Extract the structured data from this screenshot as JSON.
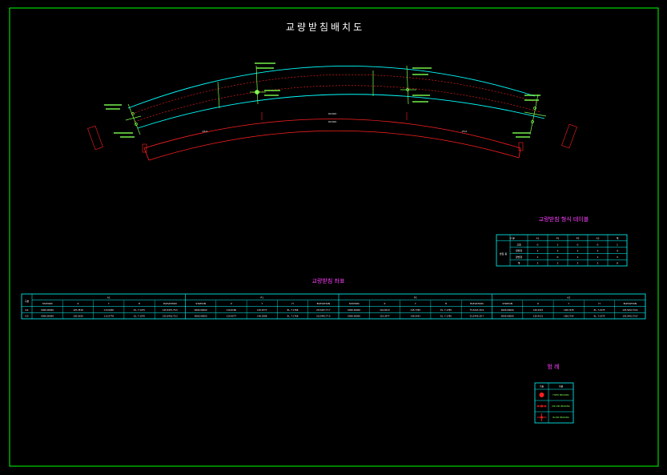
{
  "title": "교량받침배치도",
  "summary_table": {
    "title": "교량받침 형식 테이블",
    "header": [
      "구 분",
      "A1",
      "P1",
      "P2",
      "A2",
      "계"
    ],
    "group_label": "받침 종",
    "rows": [
      [
        "고정",
        "0",
        "1",
        "0",
        "0",
        "1"
      ],
      [
        "일방향",
        "1",
        "1",
        "1",
        "1",
        "4"
      ],
      [
        "양방향",
        "1",
        "0",
        "1",
        "1",
        "3"
      ],
      [
        "계",
        "2",
        "2",
        "2",
        "2",
        "8"
      ]
    ]
  },
  "coord_table": {
    "title": "교량받침 좌표",
    "corner_label": "구분",
    "groups": [
      "A1",
      "P1",
      "P2",
      "A2"
    ],
    "subheader": [
      "STATION",
      "X",
      "Y",
      "H",
      "ELEVATION"
    ],
    "row_labels": [
      "G1",
      "G2"
    ],
    "rows": [
      [
        "0000.00000",
        "125.7818",
        "113.0200",
        "EL. 7.1275",
        "125,5457,75.5",
        "0000.00000",
        "119.0180",
        "145.6777",
        "EL. 7.1766",
        "25,5447,77.7",
        "0000.00000",
        "119.8413",
        "145.7765",
        "EL. 7.1785",
        "75,5447,29.9",
        "0000.00000",
        "126.3415",
        "168.7478",
        "EL. 7.1575",
        "125,5452,79.9"
      ],
      [
        "0000.00000",
        "130.0100",
        "113.5778",
        "EL. 7.1570",
        "125,5452,75.2",
        "0000.00000",
        "119.4577",
        "146.5588",
        "EL. 7.1768",
        "25,5445,77.5",
        "0000.00000",
        "119.3977",
        "146.5541",
        "EL. 7.1780",
        "25,5445,29.7",
        "0000.00000",
        "130.4121",
        "168.1714",
        "EL. 7.1575",
        "125,5452,75.9"
      ]
    ]
  },
  "legend": {
    "title": "범 례",
    "header": [
      "기호",
      "구분"
    ],
    "items": [
      {
        "icon": "fixed-bearing-icon",
        "label": "FIXED BEARING"
      },
      {
        "icon": "uni-bearing-icon",
        "label": "UNI-DIR BEARING"
      },
      {
        "icon": "bi-bearing-icon",
        "label": "BI-DIR BEARING"
      }
    ]
  },
  "plan": {
    "span_labels": [
      "25.0",
      "40.000",
      "25.0"
    ],
    "span_sub_labels": [
      "40.000"
    ],
    "support_marks": [
      "A1",
      "P1",
      "P2",
      "A2"
    ]
  },
  "colors": {
    "frame": "#00ff00",
    "cyan": "#00ffff",
    "red": "#ff2020",
    "green": "#7cff4f",
    "magenta": "#ff3cff",
    "white": "#ffffff"
  }
}
